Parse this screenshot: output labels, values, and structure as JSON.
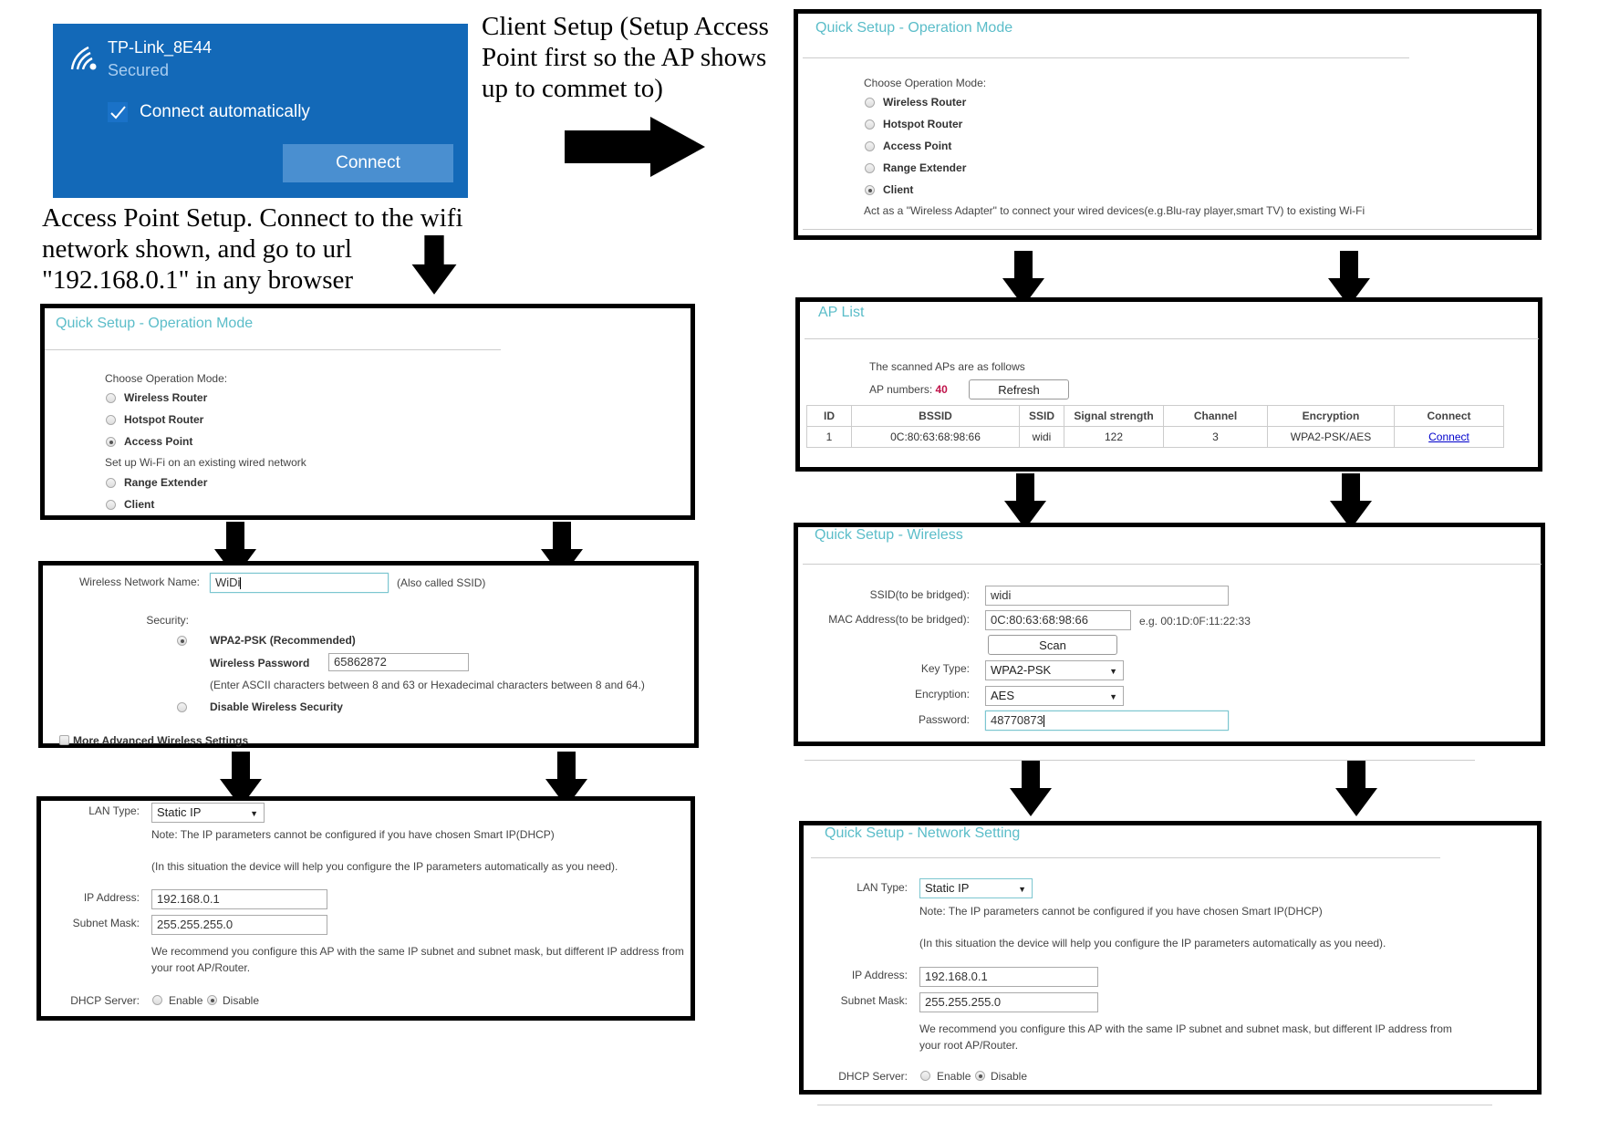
{
  "wifi_flyout": {
    "network_name": "TP-Link_8E44",
    "status": "Secured",
    "connect_automatically_label": "Connect automatically",
    "connect_automatically_checked": true,
    "connect_button": "Connect",
    "icon": "wifi-secured-icon",
    "accent_color": "#1369b8"
  },
  "annotations": {
    "client_setup": "Client Setup (Setup Access Point first so the AP shows up to commet to)",
    "access_point_setup": "Access Point Setup. Connect to the wifi network shown, and go to url \"192.168.0.1\" in any browser"
  },
  "client_op_mode": {
    "title": "Quick Setup - Operation Mode",
    "prompt": "Choose Operation Mode:",
    "options": [
      "Wireless Router",
      "Hotspot Router",
      "Access Point",
      "Range Extender",
      "Client"
    ],
    "selected": "Client",
    "description": "Act as a \"Wireless Adapter\" to connect your wired devices(e.g.Blu-ray player,smart TV) to existing Wi-Fi"
  },
  "ap_op_mode": {
    "title": "Quick Setup - Operation Mode",
    "prompt": "Choose Operation Mode:",
    "options": [
      "Wireless Router",
      "Hotspot Router",
      "Access Point",
      "Range Extender",
      "Client"
    ],
    "selected": "Access Point",
    "description": "Set up Wi-Fi on an existing wired network"
  },
  "ap_list": {
    "title": "AP List",
    "intro": "The scanned APs are as follows",
    "count_label": "AP numbers:",
    "count": "40",
    "count_color": "#c0134a",
    "refresh_button": "Refresh",
    "columns": [
      "ID",
      "BSSID",
      "SSID",
      "Signal strength",
      "Channel",
      "Encryption",
      "Connect"
    ],
    "rows": [
      {
        "id": "1",
        "bssid": "0C:80:63:68:98:66",
        "ssid": "widi",
        "signal": "122",
        "channel": "3",
        "encryption": "WPA2-PSK/AES",
        "connect": "Connect"
      }
    ]
  },
  "client_wireless": {
    "title": "Quick Setup - Wireless",
    "ssid_label": "SSID(to be bridged):",
    "ssid_value": "widi",
    "mac_label": "MAC Address(to be bridged):",
    "mac_value": "0C:80:63:68:98:66",
    "mac_hint": "e.g. 00:1D:0F:11:22:33",
    "scan_button": "Scan",
    "key_type_label": "Key Type:",
    "key_type_value": "WPA2-PSK",
    "encryption_label": "Encryption:",
    "encryption_value": "AES",
    "password_label": "Password:",
    "password_value": "48770873"
  },
  "ap_wireless": {
    "name_label": "Wireless Network Name:",
    "name_value": "WiDi",
    "name_hint": "(Also called SSID)",
    "security_label": "Security:",
    "wpa_option": "WPA2-PSK (Recommended)",
    "wpa_selected": true,
    "password_label": "Wireless Password",
    "password_value": "65862872",
    "password_hint": "(Enter ASCII characters between 8 and 63 or Hexadecimal characters between 8 and 64.)",
    "disable_option": "Disable Wireless Security",
    "advanced_label": "More Advanced Wireless Settings",
    "advanced_checked": false
  },
  "ap_network": {
    "lan_type_label": "LAN Type:",
    "lan_type_value": "Static IP",
    "note1": "Note: The IP parameters cannot be configured if you have chosen Smart IP(DHCP)",
    "note2": "(In this situation the device will help you configure the IP parameters automatically as you need).",
    "ip_label": "IP Address:",
    "ip_value": "192.168.0.1",
    "mask_label": "Subnet Mask:",
    "mask_value": "255.255.255.0",
    "recommend_line1": "We recommend you configure this AP with the same IP subnet and subnet mask, but different IP address from",
    "recommend_line2": "your root AP/Router.",
    "dhcp_label": "DHCP Server:",
    "dhcp_enable": "Enable",
    "dhcp_disable": "Disable",
    "dhcp_selected": "Disable"
  },
  "client_network": {
    "title": "Quick Setup - Network Setting",
    "lan_type_label": "LAN Type:",
    "lan_type_value": "Static IP",
    "note1": "Note: The IP parameters cannot be configured if you have chosen Smart IP(DHCP)",
    "note2": "(In this situation the device will help you configure the IP parameters automatically as you need).",
    "ip_label": "IP Address:",
    "ip_value": "192.168.0.1",
    "mask_label": "Subnet Mask:",
    "mask_value": "255.255.255.0",
    "recommend_line1": "We recommend you configure this AP with the same IP subnet and subnet mask, but different IP address from",
    "recommend_line2": "your root AP/Router.",
    "dhcp_label": "DHCP Server:",
    "dhcp_enable": "Enable",
    "dhcp_disable": "Disable",
    "dhcp_selected": "Disable"
  }
}
